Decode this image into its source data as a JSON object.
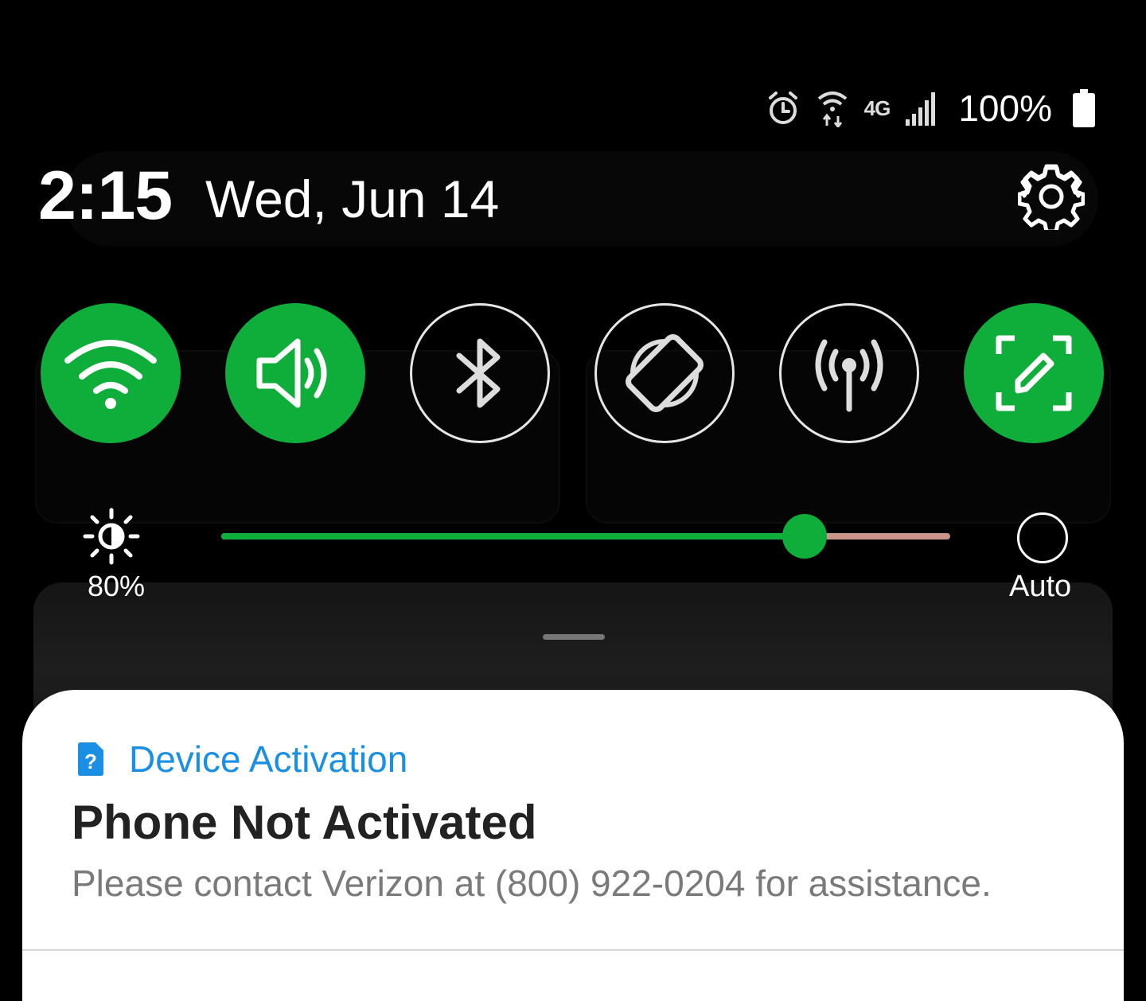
{
  "status_bar": {
    "icons": [
      "alarm-icon",
      "wifi-calling-icon",
      "signal-icon"
    ],
    "network_type": "4G",
    "battery_percent": "100%"
  },
  "header": {
    "time": "2:15",
    "date": "Wed, Jun 14"
  },
  "quick_toggles": [
    {
      "name": "wifi",
      "icon": "wifi-icon",
      "on": true
    },
    {
      "name": "sound",
      "icon": "speaker-icon",
      "on": true
    },
    {
      "name": "bluetooth",
      "icon": "bluetooth-icon",
      "on": false
    },
    {
      "name": "auto-rotate",
      "icon": "rotate-icon",
      "on": false
    },
    {
      "name": "mobile-hotspot",
      "icon": "hotspot-icon",
      "on": false
    },
    {
      "name": "screenshot-edit",
      "icon": "screen-edit-icon",
      "on": true
    }
  ],
  "brightness": {
    "percent_label": "80%",
    "level": 0.8,
    "auto_label": "Auto"
  },
  "colors": {
    "accent": "#0fae3a",
    "slider_remaining": "#c9958a",
    "notification_app": "#1a8fe3"
  },
  "notification": {
    "app_name": "Device Activation",
    "title": "Phone Not Activated",
    "body": "Please contact Verizon at (800) 922-0204 for assistance."
  }
}
